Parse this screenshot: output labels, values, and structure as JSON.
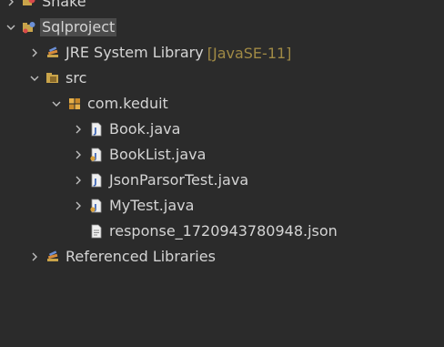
{
  "tree": {
    "items": [
      {
        "label": "Snake",
        "expanded": false,
        "icon": "project-icon"
      },
      {
        "label": "Sqlproject",
        "expanded": true,
        "icon": "project-icon"
      },
      {
        "label": "JRE System Library",
        "decoration": "[JavaSE-11]",
        "expanded": false,
        "icon": "library-icon"
      },
      {
        "label": "src",
        "expanded": true,
        "icon": "source-folder-icon"
      },
      {
        "label": "com.keduit",
        "expanded": true,
        "icon": "package-icon"
      },
      {
        "label": "Book.java",
        "expanded": false,
        "icon": "java-file-icon"
      },
      {
        "label": "BookList.java",
        "expanded": false,
        "icon": "java-file-icon"
      },
      {
        "label": "JsonParsorTest.java",
        "expanded": false,
        "icon": "java-file-icon"
      },
      {
        "label": "MyTest.java",
        "expanded": false,
        "icon": "java-file-icon"
      },
      {
        "label": "response_1720943780948.json",
        "icon": "json-file-icon"
      },
      {
        "label": "Referenced Libraries",
        "expanded": false,
        "icon": "library-icon"
      }
    ]
  },
  "colors": {
    "background": "#2b2b2b",
    "text": "#d4d4d4",
    "decoration": "#a08a45",
    "selection": "#4b4b4b"
  }
}
